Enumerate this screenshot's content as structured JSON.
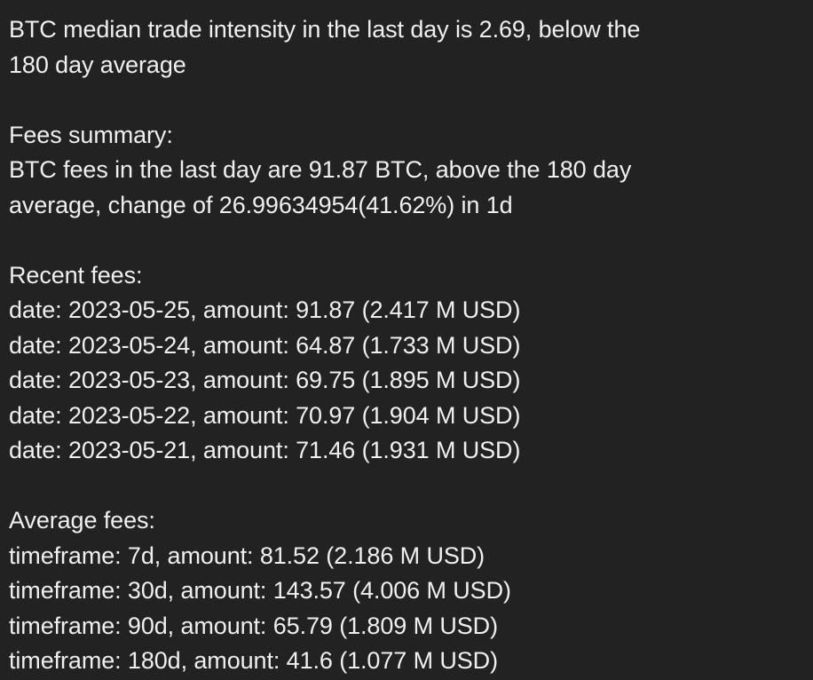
{
  "theme": {
    "background": "#222222",
    "text": "#efefef"
  },
  "message": {
    "intensity_line1": "BTC median trade intensity in the last day is 2.69, below the",
    "intensity_line2": "180 day average",
    "fees_summary_heading": "Fees summary:",
    "fees_summary_line1": "BTC fees in the last day are 91.87 BTC, above the 180 day",
    "fees_summary_line2": "average, change of 26.99634954(41.62%) in 1d",
    "recent_fees_heading": "Recent fees:",
    "recent_fees": [
      "date: 2023-05-25, amount: 91.87 (2.417 M USD)",
      "date: 2023-05-24, amount: 64.87 (1.733 M USD)",
      "date: 2023-05-23, amount: 69.75 (1.895 M USD)",
      "date: 2023-05-22, amount: 70.97 (1.904 M USD)",
      "date: 2023-05-21, amount: 71.46 (1.931 M USD)"
    ],
    "average_fees_heading": "Average fees:",
    "average_fees": [
      "timeframe: 7d, amount: 81.52 (2.186 M USD)",
      "timeframe: 30d, amount: 143.57 (4.006 M USD)",
      "timeframe: 90d, amount: 65.79 (1.809 M USD)",
      "timeframe: 180d, amount: 41.6 (1.077 M USD)"
    ]
  }
}
